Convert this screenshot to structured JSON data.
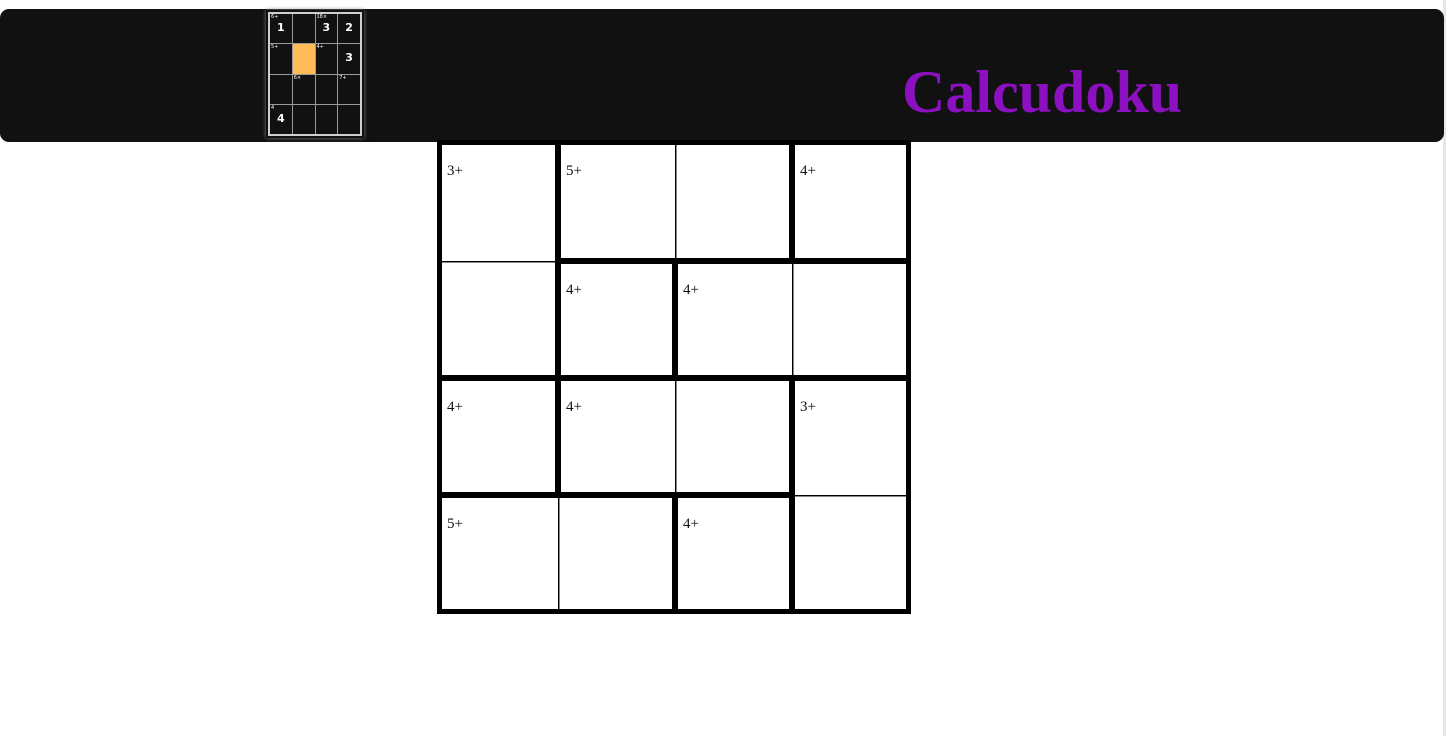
{
  "header": {
    "title": "Calcudoku",
    "title_color": "#8b10c0",
    "background": "#111111"
  },
  "logo": {
    "cells": [
      {
        "clue": "6+",
        "value": "1"
      },
      {
        "clue": "",
        "value": ""
      },
      {
        "clue": "18×",
        "value": "3"
      },
      {
        "clue": "",
        "value": "2"
      },
      {
        "clue": "5+",
        "value": ""
      },
      {
        "clue": "",
        "value": "",
        "selected": true
      },
      {
        "clue": "4+",
        "value": ""
      },
      {
        "clue": "",
        "value": "3"
      },
      {
        "clue": "",
        "value": ""
      },
      {
        "clue": "6×",
        "value": ""
      },
      {
        "clue": "",
        "value": ""
      },
      {
        "clue": "7+",
        "value": ""
      },
      {
        "clue": "4",
        "value": "4"
      },
      {
        "clue": "",
        "value": ""
      },
      {
        "clue": "",
        "value": ""
      },
      {
        "clue": "",
        "value": ""
      }
    ],
    "selected_color": "#ffbb55"
  },
  "puzzle": {
    "size": 4,
    "rows": [
      [
        "3+",
        "5+",
        "",
        "4+"
      ],
      [
        "",
        "4+",
        "4+",
        ""
      ],
      [
        "4+",
        "4+",
        "",
        "3+"
      ],
      [
        "5+",
        "",
        "4+",
        ""
      ]
    ],
    "values": [
      [
        "",
        "",
        "",
        ""
      ],
      [
        "",
        "",
        "",
        ""
      ],
      [
        "",
        "",
        "",
        ""
      ],
      [
        "",
        "",
        "",
        ""
      ]
    ]
  }
}
